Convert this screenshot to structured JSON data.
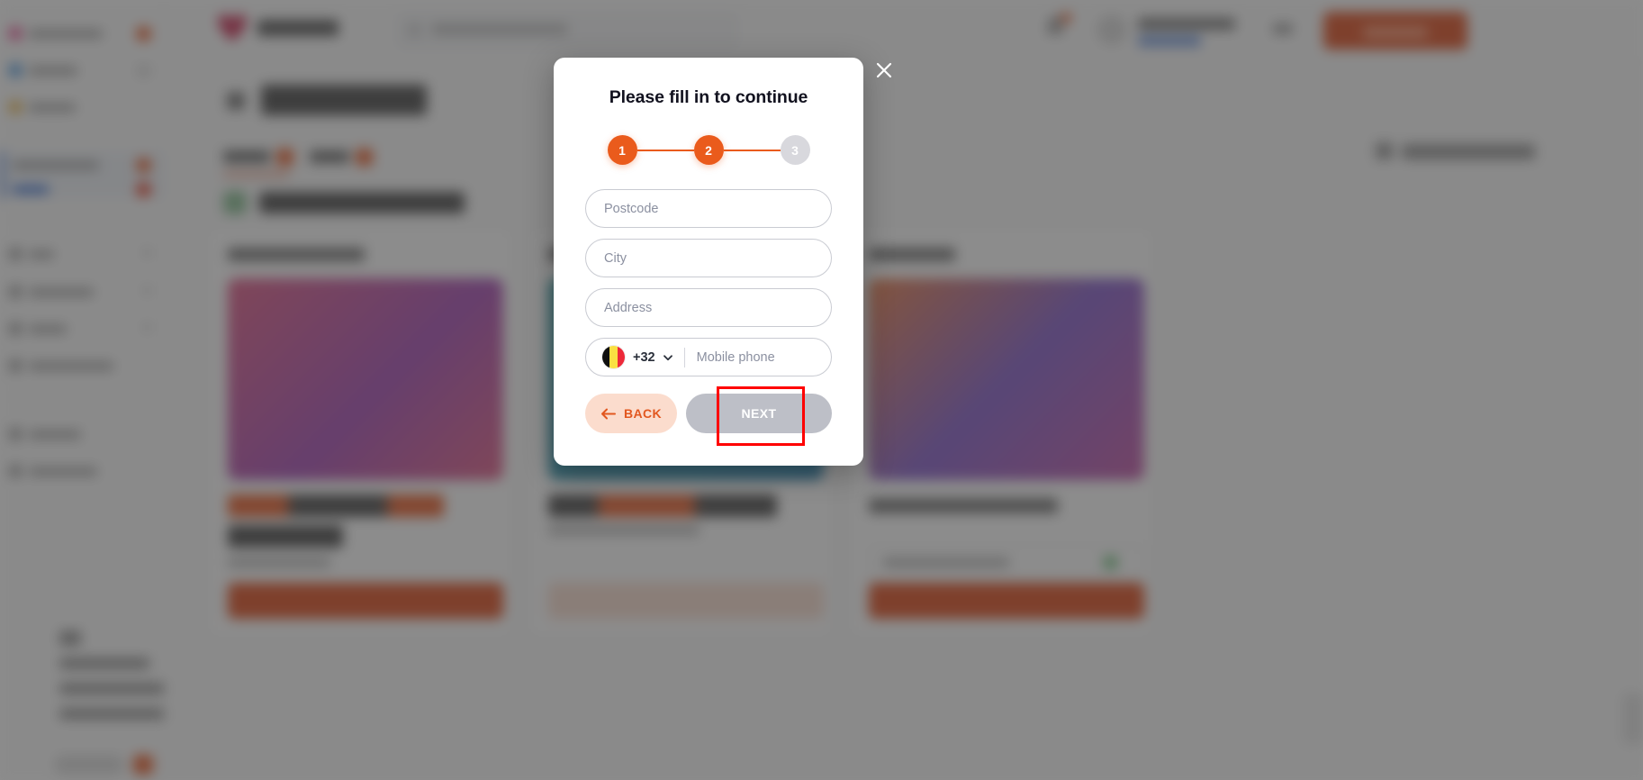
{
  "modal": {
    "title": "Please fill in to continue",
    "close_icon": "close-icon",
    "stepper": {
      "steps": [
        {
          "label": "1",
          "state": "active"
        },
        {
          "label": "2",
          "state": "active"
        },
        {
          "label": "3",
          "state": "inactive"
        }
      ],
      "active_color": "#ea5b1c",
      "inactive_color": "#d8d8dd"
    },
    "fields": [
      {
        "name": "postcode",
        "placeholder": "Postcode",
        "value": ""
      },
      {
        "name": "city",
        "placeholder": "City",
        "value": ""
      },
      {
        "name": "address",
        "placeholder": "Address",
        "value": ""
      }
    ],
    "phone": {
      "country_flag": "belgium-flag-icon",
      "dial_code": "+32",
      "caret_icon": "chevron-down-icon",
      "placeholder": "Mobile phone",
      "value": ""
    },
    "buttons": {
      "back": {
        "label": "BACK",
        "icon": "arrow-left-icon",
        "bg": "#fbdccd",
        "fg": "#e2571f"
      },
      "next": {
        "label": "NEXT",
        "disabled": true,
        "bg": "#bdbfc7",
        "fg": "#ffffff"
      }
    },
    "annotation": {
      "name": "highlight-box",
      "color": "#ff0000"
    }
  },
  "background": {
    "accent_color": "#dd4211",
    "logo_color": "#c8224b",
    "overlay_color": "rgba(64,64,64,0.60)",
    "sidebar_items": [
      {
        "badge_color": "#e8531c"
      },
      {
        "badge_color": "#d8d8d8"
      },
      {
        "badge_color": "#d8d8d8"
      }
    ],
    "promo_cards": [
      {
        "image_from": "#d84a7e",
        "image_to": "#9b3fb5",
        "title_accent": "#e8531c",
        "btn_bg": "#dd4211"
      },
      {
        "image_from": "#2f9fa8",
        "image_to": "#1f7fb0",
        "title_accent": "#e8531c",
        "btn_bg": "#fbdccd"
      },
      {
        "image_from": "#e8763f",
        "image_to": "#8f4fd0",
        "title_accent": "#6b6b6b",
        "btn_bg": "#dd4211"
      }
    ]
  }
}
